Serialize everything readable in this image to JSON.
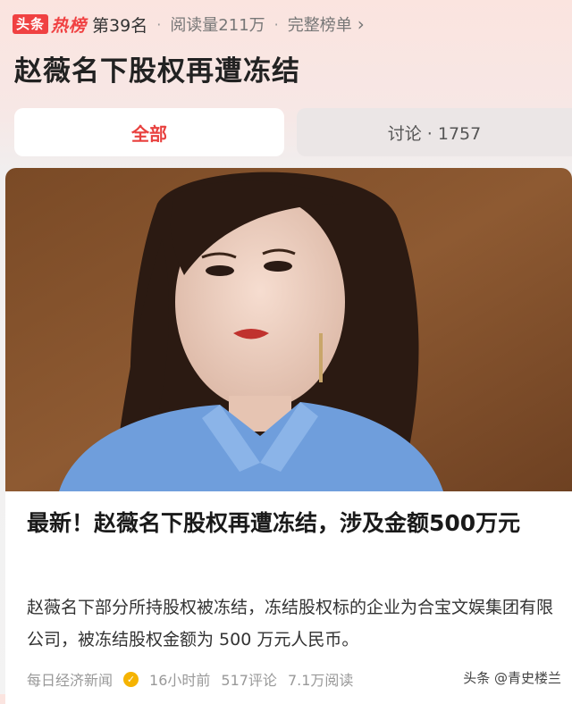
{
  "rank_bar": {
    "logo_text": "头条",
    "logo_hot": "热榜",
    "rank": "第39名",
    "reads": "阅读量211万",
    "full_list": "完整榜单",
    "dot": "·"
  },
  "topic_title": "赵薇名下股权再遭冻结",
  "tabs": [
    {
      "label": "全部"
    },
    {
      "label": "讨论 · 1757"
    }
  ],
  "article": {
    "headline": "最新！赵薇名下股权再遭冻结，涉及金额500万元",
    "summary": "赵薇名下部分所持股权被冻结，冻结股权标的企业为合宝文娱集团有限公司，被冻结股权金额为 500 万元人民币。",
    "source": "每日经济新闻",
    "time": "16小时前",
    "comments": "517评论",
    "reads": "7.1万阅读"
  },
  "watermark": "头条 @青史楼兰",
  "colors": {
    "accent": "#f04142",
    "tab_active": "#e8413f"
  }
}
